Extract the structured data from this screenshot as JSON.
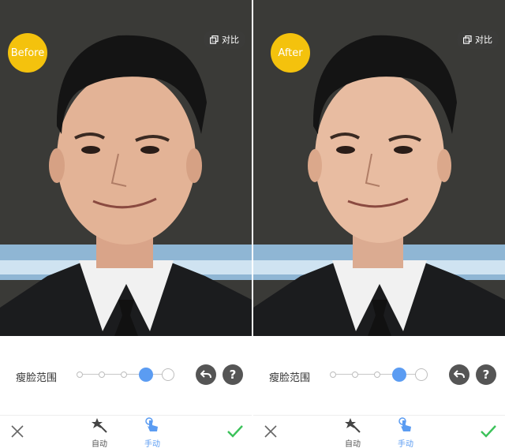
{
  "panels": [
    {
      "badge": "Before",
      "compare_label": "对比",
      "range_label": "瘦脸范围",
      "slider_level_index": 3,
      "slider_steps": 5,
      "toolbar": {
        "auto_label": "自动",
        "manual_label": "手动"
      }
    },
    {
      "badge": "After",
      "compare_label": "对比",
      "range_label": "瘦脸范围",
      "slider_level_index": 3,
      "slider_steps": 5,
      "toolbar": {
        "auto_label": "自动",
        "manual_label": "手动"
      }
    }
  ],
  "icons": {
    "compare": "copy-icon",
    "undo": "undo-icon",
    "help": "help-icon",
    "close": "close-icon",
    "auto": "magic-wand-icon",
    "manual": "finger-icon",
    "confirm": "checkmark-icon"
  },
  "colors": {
    "badge": "#f4c20d",
    "accent": "#5b9cf2",
    "confirm": "#3cc25a",
    "round_button": "#555555"
  },
  "help_glyph": "?"
}
